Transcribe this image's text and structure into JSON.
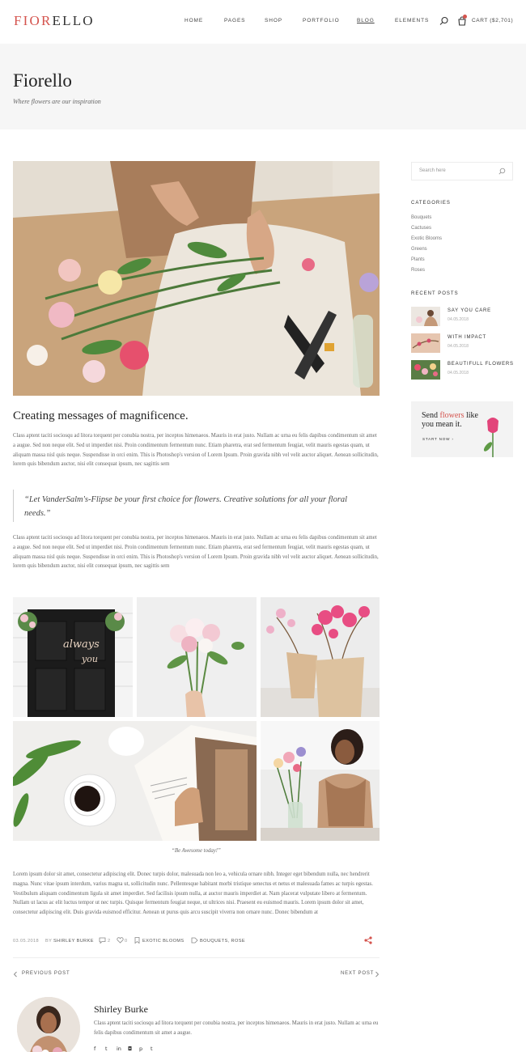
{
  "header": {
    "logo_accent": "FIOR",
    "logo_rest": "ELLO",
    "nav": [
      "HOME",
      "PAGES",
      "SHOP",
      "PORTFOLIO",
      "BLOG",
      "ELEMENTS"
    ],
    "cart_label": "CART ($2,701)"
  },
  "banner": {
    "title": "Fiorello",
    "subtitle": "Where flowers are our inspiration"
  },
  "post": {
    "title": "Creating messages of magnificence.",
    "paragraph1": "Class aptent taciti sociosqu ad litora torquent per conubia nostra, per inceptos himenaeos. Mauris in erat justo. Nullam ac urna eu felis dapibus condimentum sit amet a augue. Sed non neque elit. Sed ut imperdiet nisi. Proin condimentum fermentum nunc. Etiam pharetra, erat sed fermentum feugiat, velit mauris egestas quam, ut aliquam massa nisl quis neque. Suspendisse in orci enim. This is Photoshop's version of Lorem Ipsum. Proin gravida nibh vel velit auctor aliquet. Aenean sollicitudin, lorem quis bibendum auctor, nisi elit consequat ipsum, nec sagittis sem",
    "quote": "“Let VanderSalm's-Flipse be your first choice for flowers. Creative solutions for all your floral needs.”",
    "paragraph2": "Class aptent taciti sociosqu ad litora torquent per conubia nostra, per inceptos himenaeos. Mauris in erat justo. Nullam ac urna eu felis dapibus condimentum sit amet a augue. Sed non neque elit. Sed ut imperdiet nisi. Proin condimentum fermentum nunc. Etiam pharetra, erat sed fermentum feugiat, velit mauris egestas quam, ut aliquam massa nisl quis neque. Suspendisse in orci enim. This is Photoshop's version of Lorem Ipsum. Proin gravida nibh vel velit auctor aliquet. Aenean sollicitudin, lorem quis bibendum auctor, nisi elit consequat ipsum, nec sagittis sem",
    "gallery_caption": "“Be Awesome today!”",
    "paragraph3": "Lorem ipsum dolor sit amet, consectetur adipiscing elit. Donec turpis dolor, malesuada non leo a, vehicula ornare nibh. Integer eget bibendum nulla, nec hendrerit magna. Nunc vitae ipsum interdum, varius magna ut, sollicitudin nunc. Pellentesque habitant morbi tristique senectus et netus et malesuada fames ac turpis egestas. Vestibulum aliquam condimentum ligula sit amet imperdiet. Sed facilisis ipsum nulla, at auctor mauris imperdiet at. Nam placerat vulputate libero at fermentum. Nullam ut lacus ac elit luctus tempor ut nec turpis. Quisque fermentum feugiat neque, ut ultrices nisi. Praesent eu euismod mauris. Lorem ipsum dolor sit amet, consectetur adipiscing elit. Duis gravida euismod efficitur. Aenean ut purus quis arcu suscipit viverra non ornare nunc. Donec bibendum at",
    "meta": {
      "date": "03.05.2018",
      "by_prefix": "BY",
      "author": "SHIRLEY BURKE",
      "comments": "2",
      "likes": "0",
      "category": "EXOTIC BLOOMS",
      "tags": "BOUQUETS, ROSE"
    },
    "prev_label": "PREVIOUS POST",
    "next_label": "NEXT POST"
  },
  "author": {
    "name": "Shirley Burke",
    "bio": "Class aptent taciti sociosqu ad litora torquent per conubia nostra, per inceptos himenaeos. Mauris in erat justo. Nullam ac urna eu felis dapibus condimentum sit amet a augue."
  },
  "sidebar": {
    "search_placeholder": "Search here",
    "categories_heading": "CATEGORIES",
    "categories": [
      "Bouquets",
      "Cactuses",
      "Exotic Blooms",
      "Greens",
      "Plants",
      "Roses"
    ],
    "recent_heading": "RECENT POSTS",
    "recent_posts": [
      {
        "title": "SAY YOU CARE",
        "date": "04.05.2018"
      },
      {
        "title": "WITH IMPACT",
        "date": "04.05.2018"
      },
      {
        "title": "BEAUTIFULL FLOWERS",
        "date": "04.05.2018"
      }
    ],
    "promo": {
      "line1_start": "Send ",
      "line1_accent": "flowers",
      "line1_end": " like",
      "line2": "you mean it.",
      "link": "START NOW ›"
    }
  },
  "colors": {
    "accent": "#d4534d",
    "banner_bg": "#f6f6f6",
    "text_dark": "#222222"
  },
  "icons": [
    "search-icon",
    "cart-icon",
    "comment-icon",
    "heart-icon",
    "bookmark-icon",
    "tag-icon",
    "share-icon",
    "chevron-left-icon",
    "chevron-right-icon",
    "facebook-icon",
    "twitter-icon",
    "linkedin-icon",
    "instagram-icon",
    "pinterest-icon",
    "tumblr-icon"
  ]
}
